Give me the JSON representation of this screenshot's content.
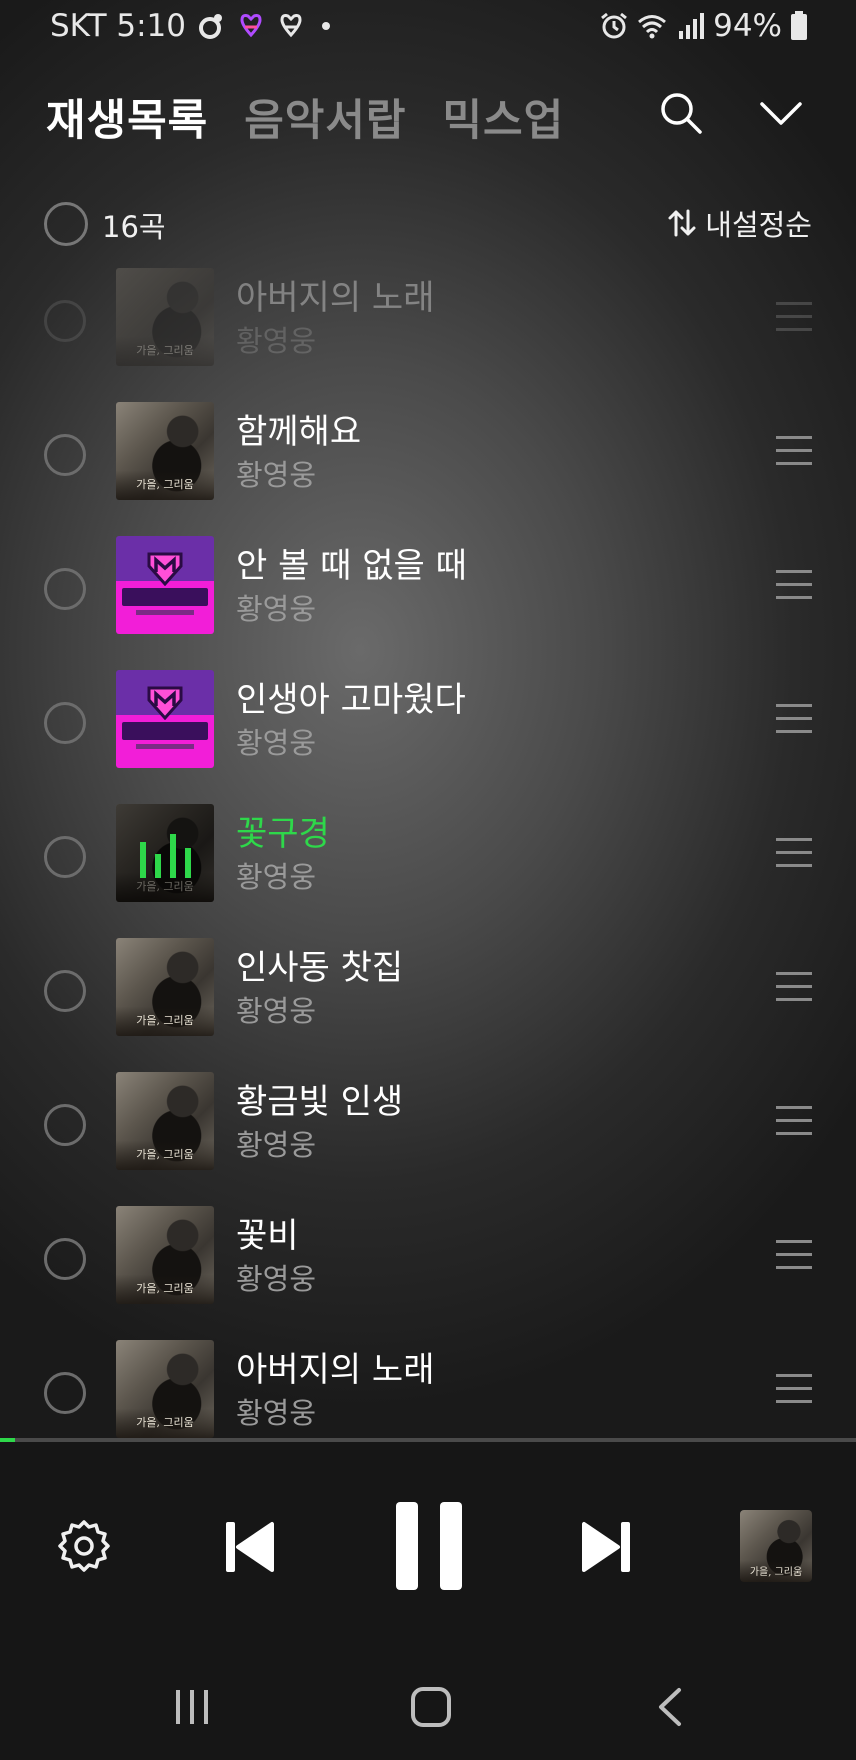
{
  "status": {
    "carrier_time": "SKT 5:10",
    "battery": "94%",
    "icons": [
      "camera-badge-icon",
      "heart-link-icon",
      "heart-link-icon",
      "dot-icon",
      "alarm-icon",
      "wifi-icon",
      "signal-icon",
      "battery-icon"
    ]
  },
  "tabs": [
    "재생목록",
    "음악서랍",
    "믹스업"
  ],
  "header_icons": [
    "search-icon",
    "chevron-down-icon"
  ],
  "list_header": {
    "count": "16곡",
    "sort": "내설정순"
  },
  "tracks": [
    {
      "title": "아버지의 노래",
      "artist": "황영웅",
      "art": "autumn",
      "faded": true
    },
    {
      "title": "함께해요",
      "artist": "황영웅",
      "art": "autumn"
    },
    {
      "title": "안 볼 때 없을 때",
      "artist": "황영웅",
      "art": "show"
    },
    {
      "title": "인생아 고마웠다",
      "artist": "황영웅",
      "art": "show"
    },
    {
      "title": "꽃구경",
      "artist": "황영웅",
      "art": "autumn",
      "playing": true
    },
    {
      "title": "인사동 찻집",
      "artist": "황영웅",
      "art": "autumn"
    },
    {
      "title": "황금빛 인생",
      "artist": "황영웅",
      "art": "autumn"
    },
    {
      "title": "꽃비",
      "artist": "황영웅",
      "art": "autumn"
    },
    {
      "title": "아버지의 노래",
      "artist": "황영웅",
      "art": "autumn"
    }
  ],
  "album_caption": "가을, 그리움",
  "progress_fraction": 0.018,
  "colors": {
    "accent": "#2ed84a",
    "purple": "#6b2fa8",
    "pink": "#f21ed8"
  },
  "player_icons": [
    "settings-icon",
    "previous-icon",
    "pause-icon",
    "next-icon",
    "album-thumbnail"
  ],
  "nav_icons": [
    "recent-apps-icon",
    "home-icon",
    "back-icon"
  ]
}
